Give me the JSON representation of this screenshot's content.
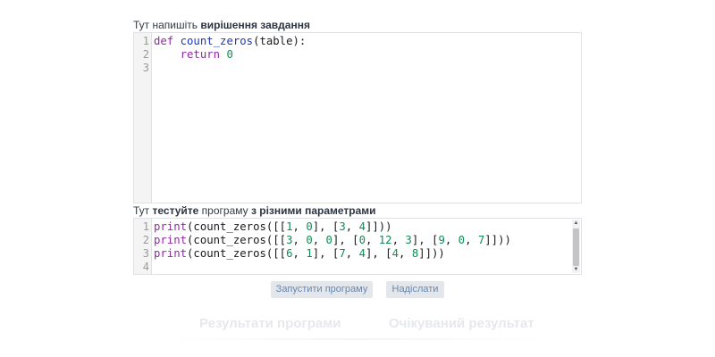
{
  "solution_label": {
    "prefix": "Тут напишіть ",
    "bold": "вирішення завдання"
  },
  "solution_editor": {
    "lines": [
      {
        "n": "1"
      },
      {
        "n": "2"
      },
      {
        "n": "3"
      }
    ],
    "tokens": {
      "def": "def",
      "func": "count_zeros",
      "params": "(table):",
      "return": "return",
      "zero": "0"
    }
  },
  "test_label": {
    "p1": "Тут ",
    "b1": "тестуйте",
    "p2": " програму ",
    "b2": "з різними параметрами"
  },
  "test_editor": {
    "line_numbers": [
      "1",
      "2",
      "3",
      "4"
    ],
    "print_kw": "print",
    "line1": {
      "pre": "(count_zeros([[",
      "n1": "1",
      "s1": ", ",
      "n2": "0",
      "s2": "], [",
      "n3": "3",
      "s3": ", ",
      "n4": "4",
      "post": "]]))"
    },
    "line2": {
      "pre": "(count_zeros([[",
      "n1": "3",
      "s1": ", ",
      "n2": "0",
      "s2": ", ",
      "n3": "0",
      "s3": "], [",
      "n4": "0",
      "s4": ", ",
      "n5": "12",
      "s5": ", ",
      "n6": "3",
      "s6": "], [",
      "n7": "9",
      "s7": ", ",
      "n8": "0",
      "s8": ", ",
      "n9": "7",
      "post": "]]))"
    },
    "line3": {
      "pre": "(count_zeros([[",
      "n1": "6",
      "s1": ", ",
      "n2": "1",
      "s2": "], [",
      "n3": "7",
      "s3": ", ",
      "n4": "4",
      "s4": "], [",
      "n5": "4",
      "s5": ", ",
      "n6": "8",
      "post": "]]))"
    }
  },
  "buttons": {
    "run": "Запустити програму",
    "send": "Надіслати"
  },
  "results": {
    "program_title": "Результати програми",
    "expected_title": "Очікуваний результат"
  },
  "colors": {
    "keyword": "#8f2aa3",
    "function": "#1b36c9",
    "number": "#138a53",
    "button_bg": "#e3e7ec",
    "button_text": "#6a86ab"
  }
}
